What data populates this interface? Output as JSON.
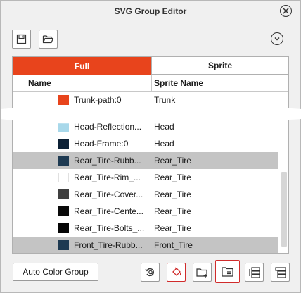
{
  "window": {
    "title": "SVG Group Editor"
  },
  "tabs": [
    {
      "label": "Full",
      "active": true
    },
    {
      "label": "Sprite",
      "active": false
    }
  ],
  "columns": {
    "name": "Name",
    "sprite_name": "Sprite Name"
  },
  "rows": [
    {
      "name": "Trunk-path:0",
      "sprite": "Trunk",
      "color": "#e8441c",
      "selected": false
    },
    {
      "name": "Head-Reflection...",
      "sprite": "Head",
      "color": "#a8d8ea",
      "selected": false
    },
    {
      "name": "Head-Frame:0",
      "sprite": "Head",
      "color": "#0c2035",
      "selected": false
    },
    {
      "name": "Rear_Tire-Rubb...",
      "sprite": "Rear_Tire",
      "color": "#1e3a52",
      "selected": true
    },
    {
      "name": "Rear_Tire-Rim_...",
      "sprite": "Rear_Tire",
      "color": "#ffffff",
      "selected": false
    },
    {
      "name": "Rear_Tire-Cover...",
      "sprite": "Rear_Tire",
      "color": "#404040",
      "selected": false
    },
    {
      "name": "Rear_Tire-Cente...",
      "sprite": "Rear_Tire",
      "color": "#0a0a0a",
      "selected": false
    },
    {
      "name": "Rear_Tire-Bolts_...",
      "sprite": "Rear_Tire",
      "color": "#050505",
      "selected": false
    },
    {
      "name": "Front_Tire-Rubb...",
      "sprite": "Front_Tire",
      "color": "#1e3a52",
      "selected": true
    }
  ],
  "buttons": {
    "auto_color_group": "Auto Color Group"
  },
  "colors": {
    "accent": "#e8441c",
    "selected_row": "#c4c4c4",
    "active_border": "#d02b2b"
  }
}
